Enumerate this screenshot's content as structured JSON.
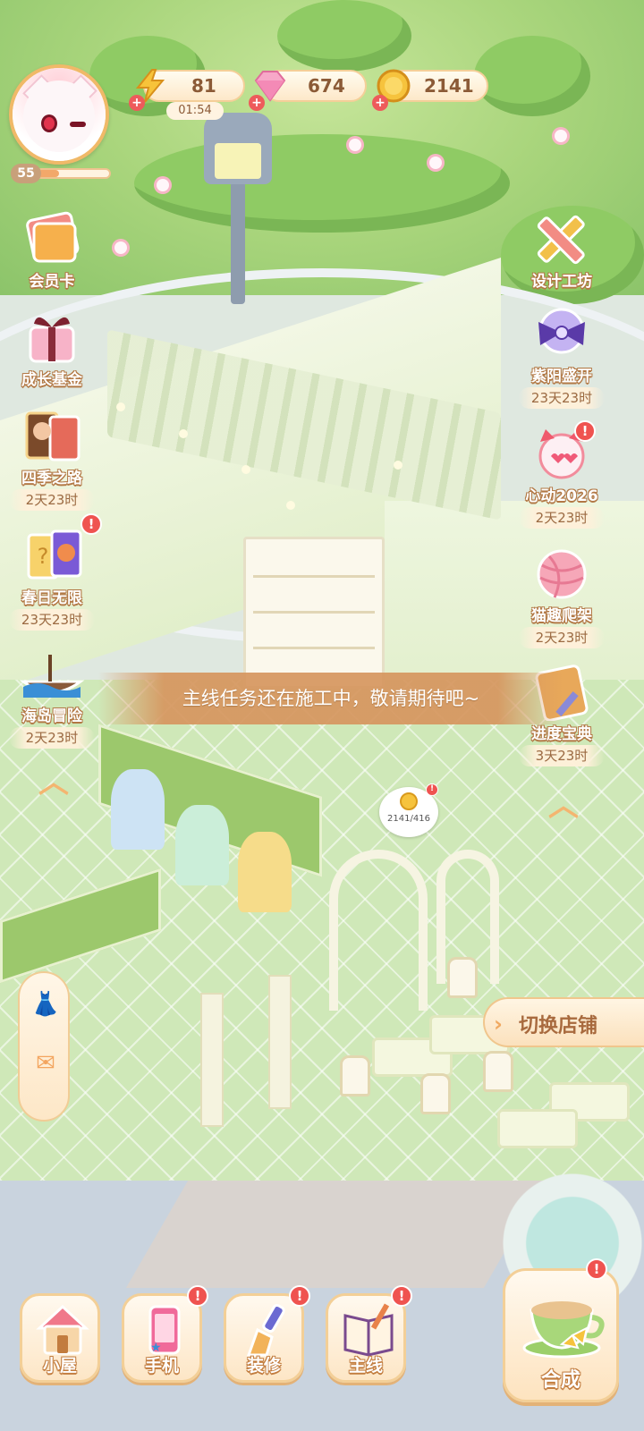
{
  "player": {
    "level": "55",
    "level_progress": 0.3
  },
  "resources": {
    "energy": {
      "value": "81",
      "timer": "01:54",
      "icon": "lightning-icon"
    },
    "gems": {
      "value": "674",
      "icon": "pink-gem-icon"
    },
    "coins": {
      "value": "2141",
      "icon": "gold-coin-icon"
    }
  },
  "left_menu": [
    {
      "label": "会员卡",
      "icon": "membership-card-icon"
    },
    {
      "label": "成长基金",
      "icon": "gift-box-icon"
    },
    {
      "label": "四季之路",
      "timer": "2天23时",
      "icon": "season-cards-icon"
    },
    {
      "label": "春日无限",
      "timer": "23天23时",
      "icon": "question-cards-icon",
      "badge": "!"
    },
    {
      "label": "海岛冒险",
      "timer": "2天23时",
      "icon": "island-boat-icon"
    }
  ],
  "right_menu": [
    {
      "label": "设计工坊",
      "icon": "pencil-ruler-icon"
    },
    {
      "label": "紫阳盛开",
      "timer": "23天23时",
      "icon": "purple-bow-icon"
    },
    {
      "label": "心动2026",
      "timer": "2天23时",
      "icon": "heart-cat-icon",
      "badge": "!"
    },
    {
      "label": "猫趣爬架",
      "timer": "2天23时",
      "icon": "yarn-ball-icon"
    },
    {
      "label": "进度宝典",
      "timer": "3天23时",
      "icon": "progress-book-icon"
    }
  ],
  "toast": "主线任务还在施工中，敬请期待吧~",
  "coin_bubble": {
    "value": "2141/416",
    "badge": "!"
  },
  "switch_shop": "切换店铺",
  "bottom_nav": [
    {
      "label": "小屋",
      "icon": "house-icon"
    },
    {
      "label": "手机",
      "icon": "phone-icon",
      "badge": "!"
    },
    {
      "label": "装修",
      "icon": "paint-brush-icon",
      "badge": "!"
    },
    {
      "label": "主线",
      "icon": "story-book-icon",
      "badge": "!"
    }
  ],
  "synthesize": {
    "label": "合成",
    "icon": "teacup-icon",
    "badge": "!"
  },
  "colors": {
    "accent": "#f3cf97",
    "alert": "#ef5350",
    "label_outline": "#b27845",
    "grass": "#a9d57c"
  }
}
